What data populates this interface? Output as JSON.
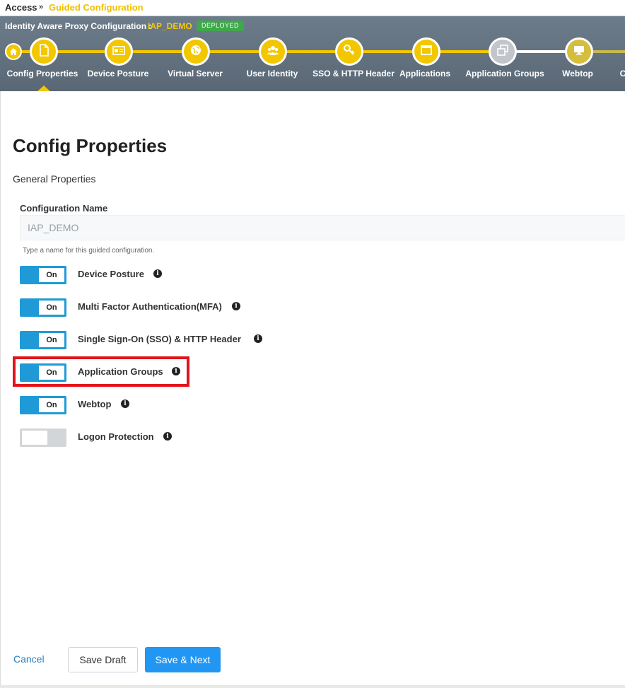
{
  "breadcrumb": {
    "root": "Access",
    "separator": "»",
    "current": "Guided Configuration"
  },
  "header": {
    "title": "Identity Aware Proxy Configuration :",
    "config_name": "IAP_DEMO",
    "status_badge": "DEPLOYED"
  },
  "steps": [
    {
      "label": "Config Properties",
      "icon": "document-icon",
      "active": true
    },
    {
      "label": "Device Posture",
      "icon": "id-card-icon"
    },
    {
      "label": "Virtual Server",
      "icon": "globe-icon"
    },
    {
      "label": "User Identity",
      "icon": "users-icon"
    },
    {
      "label": "SSO & HTTP Header",
      "icon": "key-icon"
    },
    {
      "label": "Applications",
      "icon": "window-icon"
    },
    {
      "label": "Application Groups",
      "icon": "copy-icon"
    },
    {
      "label": "Webtop",
      "icon": "monitor-icon"
    },
    {
      "label": "C",
      "icon": ""
    }
  ],
  "page": {
    "title": "Config Properties",
    "section": "General Properties",
    "config_name_label": "Configuration Name",
    "config_name_value": "IAP_DEMO",
    "config_name_help": "Type a name for this guided configuration."
  },
  "toggles": [
    {
      "label": "Device Posture",
      "state": "On"
    },
    {
      "label": "Multi Factor Authentication(MFA)",
      "state": "On"
    },
    {
      "label": "Single Sign-On (SSO) & HTTP Header",
      "state": "On"
    },
    {
      "label": "Application Groups",
      "state": "On",
      "highlighted": true
    },
    {
      "label": "Webtop",
      "state": "On"
    },
    {
      "label": "Logon Protection",
      "state": ""
    }
  ],
  "footer": {
    "cancel": "Cancel",
    "save_draft": "Save Draft",
    "save_next": "Save & Next"
  },
  "colors": {
    "accent_yellow": "#f2c700",
    "toggle_blue": "#1f9ad6",
    "primary_button": "#2196f3",
    "highlight_red": "#e3131b",
    "deployed_green": "#3ea84a"
  }
}
